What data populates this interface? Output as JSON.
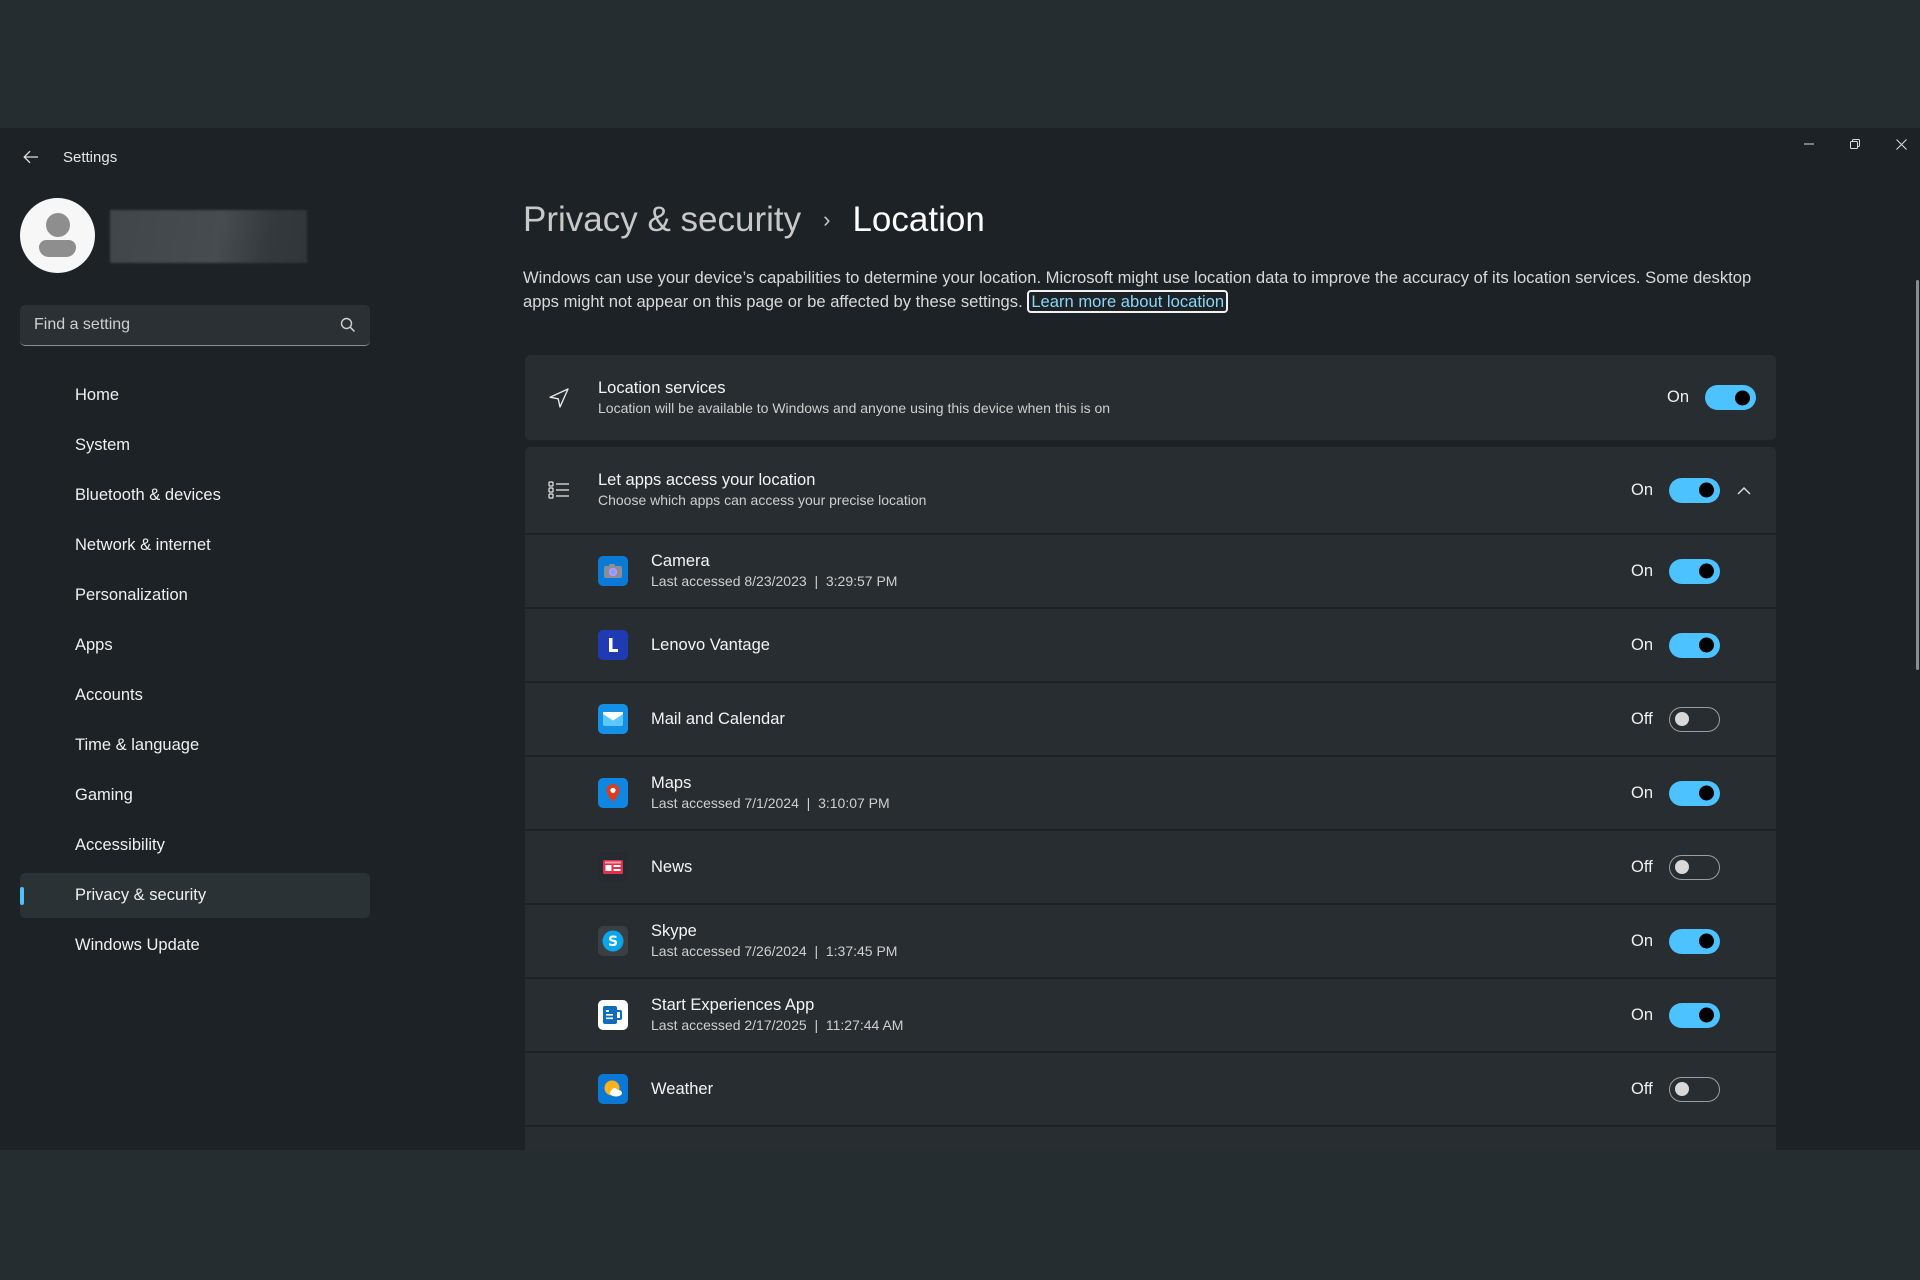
{
  "window": {
    "title": "Settings",
    "controls": {
      "minimize": "minimize",
      "maximize": "restore",
      "close": "close"
    }
  },
  "sidebar": {
    "user_name": "",
    "search": {
      "placeholder": "Find a setting",
      "value": ""
    },
    "items": [
      {
        "label": "Home",
        "selected": false
      },
      {
        "label": "System",
        "selected": false
      },
      {
        "label": "Bluetooth & devices",
        "selected": false
      },
      {
        "label": "Network & internet",
        "selected": false
      },
      {
        "label": "Personalization",
        "selected": false
      },
      {
        "label": "Apps",
        "selected": false
      },
      {
        "label": "Accounts",
        "selected": false
      },
      {
        "label": "Time & language",
        "selected": false
      },
      {
        "label": "Gaming",
        "selected": false
      },
      {
        "label": "Accessibility",
        "selected": false
      },
      {
        "label": "Privacy & security",
        "selected": true
      },
      {
        "label": "Windows Update",
        "selected": false
      }
    ]
  },
  "header": {
    "breadcrumb_parent": "Privacy & security",
    "breadcrumb_separator": "›",
    "breadcrumb_current": "Location",
    "description": "Windows can use your device’s capabilities to determine your location. Microsoft might use location data to improve the accuracy of its location services. Some desktop apps might not appear on this page or be affected by these settings.",
    "learn_more_link": "Learn more about location"
  },
  "location_services": {
    "title": "Location services",
    "subtitle": "Location will be available to Windows and anyone using this device when this is on",
    "state_label": "On",
    "enabled": true
  },
  "app_access": {
    "title": "Let apps access your location",
    "subtitle": "Choose which apps can access your precise location",
    "state_label": "On",
    "enabled": true,
    "expanded": true,
    "apps": [
      {
        "name": "Camera",
        "last_accessed": "Last accessed 8/23/2023  |  3:29:57 PM",
        "state_label": "On",
        "enabled": true,
        "icon": "camera-app-icon"
      },
      {
        "name": "Lenovo Vantage",
        "last_accessed": "",
        "state_label": "On",
        "enabled": true,
        "icon": "lenovo-vantage-app-icon"
      },
      {
        "name": "Mail and Calendar",
        "last_accessed": "",
        "state_label": "Off",
        "enabled": false,
        "icon": "mail-app-icon"
      },
      {
        "name": "Maps",
        "last_accessed": "Last accessed 7/1/2024  |  3:10:07 PM",
        "state_label": "On",
        "enabled": true,
        "icon": "maps-app-icon"
      },
      {
        "name": "News",
        "last_accessed": "",
        "state_label": "Off",
        "enabled": false,
        "icon": "news-app-icon"
      },
      {
        "name": "Skype",
        "last_accessed": "Last accessed 7/26/2024  |  1:37:45 PM",
        "state_label": "On",
        "enabled": true,
        "icon": "skype-app-icon"
      },
      {
        "name": "Start Experiences App",
        "last_accessed": "Last accessed 2/17/2025  |  11:27:44 AM",
        "state_label": "On",
        "enabled": true,
        "icon": "start-experiences-app-icon"
      },
      {
        "name": "Weather",
        "last_accessed": "",
        "state_label": "Off",
        "enabled": false,
        "icon": "weather-app-icon"
      }
    ]
  },
  "colors": {
    "accent": "#4cc2ff",
    "window_bg": "#1c2226",
    "card_bg": "#272d31",
    "link": "#8ad6f5"
  }
}
